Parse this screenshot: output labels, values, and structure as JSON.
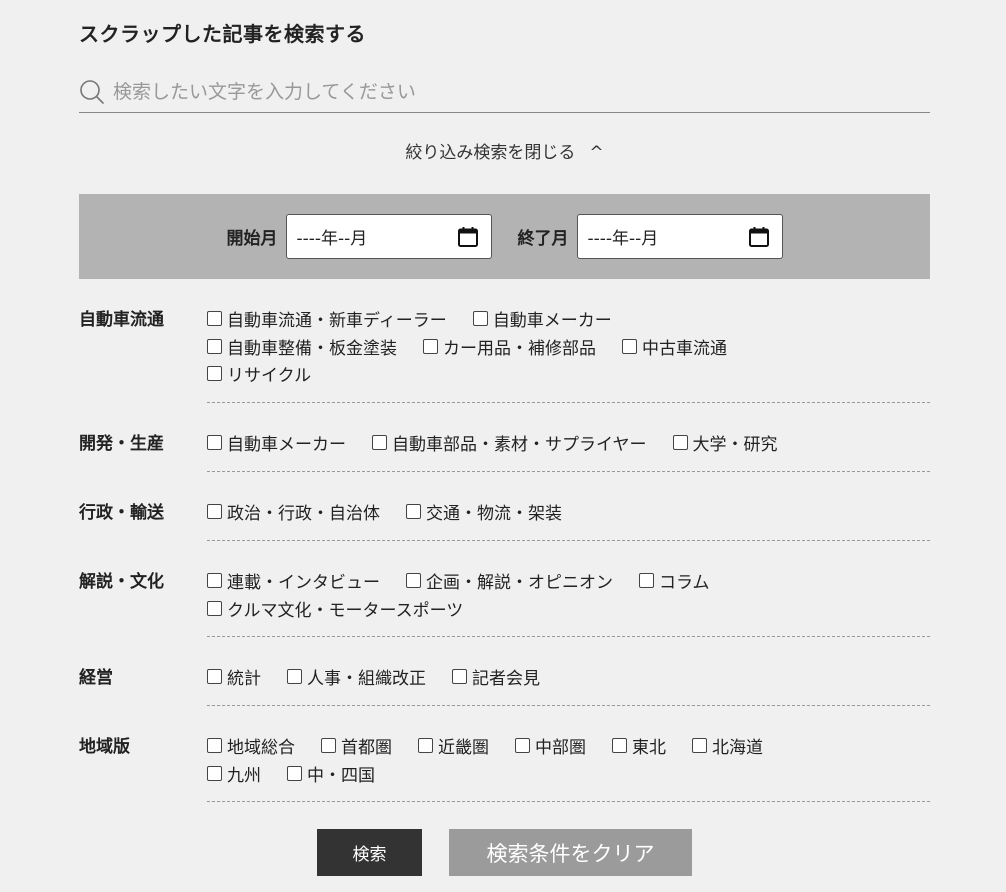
{
  "title": "スクラップした記事を検索する",
  "search": {
    "placeholder": "検索したい文字を入力してください"
  },
  "filter_toggle": {
    "label": "絞り込み検索を閉じる",
    "chevron": "^"
  },
  "date_range": {
    "start_label": "開始月",
    "start_value": "----年--月",
    "end_label": "終了月",
    "end_value": "----年--月"
  },
  "categories": [
    {
      "name": "自動車流通",
      "lines": [
        [
          "自動車流通・新車ディーラー",
          "自動車メーカー"
        ],
        [
          "自動車整備・板金塗装",
          "カー用品・補修部品",
          "中古車流通"
        ],
        [
          "リサイクル"
        ]
      ]
    },
    {
      "name": "開発・生産",
      "lines": [
        [
          "自動車メーカー",
          "自動車部品・素材・サプライヤー",
          "大学・研究"
        ]
      ]
    },
    {
      "name": "行政・輸送",
      "lines": [
        [
          "政治・行政・自治体",
          "交通・物流・架装"
        ]
      ]
    },
    {
      "name": "解説・文化",
      "lines": [
        [
          "連載・インタビュー",
          "企画・解説・オピニオン",
          "コラム"
        ],
        [
          "クルマ文化・モータースポーツ"
        ]
      ]
    },
    {
      "name": "経営",
      "lines": [
        [
          "統計",
          "人事・組織改正",
          "記者会見"
        ]
      ]
    },
    {
      "name": "地域版",
      "lines": [
        [
          "地域総合",
          "首都圏",
          "近畿圏",
          "中部圏",
          "東北",
          "北海道"
        ],
        [
          "九州",
          "中・四国"
        ]
      ]
    }
  ],
  "buttons": {
    "search": "検索",
    "clear": "検索条件をクリア"
  },
  "colors": {
    "background": "#f0f0f0",
    "date_bar": "#b3b3b3",
    "search_button": "#333333",
    "clear_button": "#9b9b9b"
  }
}
